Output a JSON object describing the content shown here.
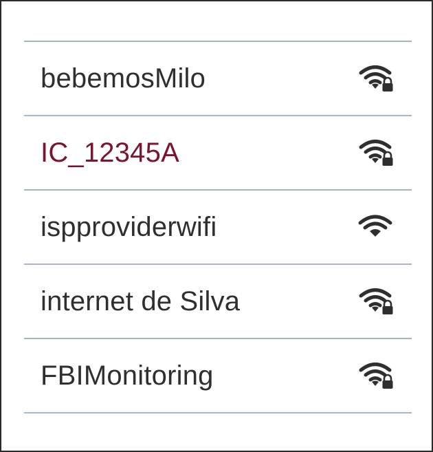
{
  "networks": [
    {
      "ssid": "bebemosMilo",
      "secured": true,
      "selected": false,
      "icon": "wifi-lock-icon"
    },
    {
      "ssid": "IC_12345A",
      "secured": true,
      "selected": true,
      "icon": "wifi-lock-icon"
    },
    {
      "ssid": "ispproviderwifi",
      "secured": false,
      "selected": false,
      "icon": "wifi-icon"
    },
    {
      "ssid": "internet de Silva",
      "secured": true,
      "selected": false,
      "icon": "wifi-lock-icon"
    },
    {
      "ssid": "FBIMonitoring",
      "secured": true,
      "selected": false,
      "icon": "wifi-lock-icon"
    }
  ],
  "colors": {
    "text": "#2f2f2f",
    "selected_text": "#7a1530",
    "divider": "#a7b4c6",
    "frame": "#2b2b2b"
  }
}
